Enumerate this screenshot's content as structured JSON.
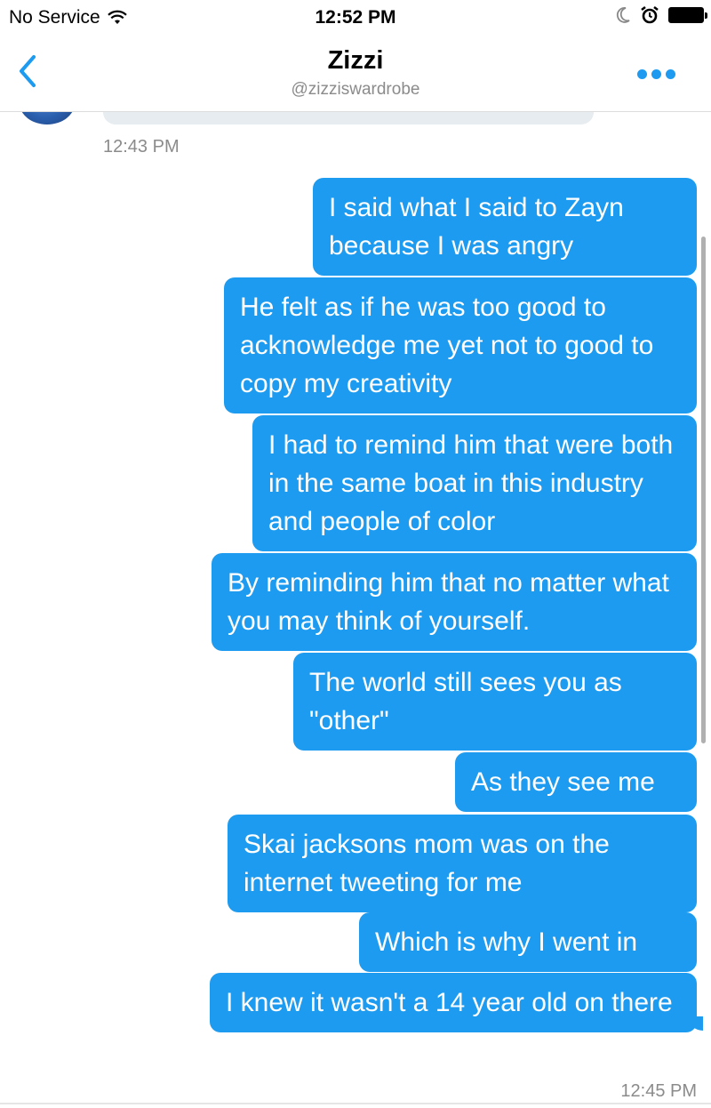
{
  "status_bar": {
    "carrier": "No Service",
    "time": "12:52 PM",
    "icons": [
      "wifi-icon",
      "moon-icon",
      "alarm-icon",
      "battery-icon"
    ]
  },
  "nav": {
    "title": "Zizzi",
    "subtitle": "@zizziswardrobe",
    "back_icon": "chevron-left-icon",
    "more_icon": "more-dots-icon"
  },
  "conversation": {
    "timestamp_top": "12:43 PM",
    "messages": [
      {
        "text": "I said what I said to Zayn because I was angry"
      },
      {
        "text": "He felt as if he was too good to acknowledge me yet not to good to copy my creativity"
      },
      {
        "text": "I had to remind him that were both in the same boat in this industry and people of color"
      },
      {
        "text": "By reminding him that no matter what you may think of yourself."
      },
      {
        "text": "The world still sees you as \"other\""
      },
      {
        "text": "As they see me"
      },
      {
        "text": "Skai jacksons mom was on the internet tweeting for me"
      },
      {
        "text": "Which is why I went in"
      },
      {
        "text": "I knew it wasn't a 14 year old on there"
      }
    ],
    "timestamp_bottom": "12:45 PM"
  },
  "colors": {
    "accent": "#1d9bf0",
    "received_bubble": "#e6ecf0",
    "muted_text": "#8b8b8b"
  }
}
